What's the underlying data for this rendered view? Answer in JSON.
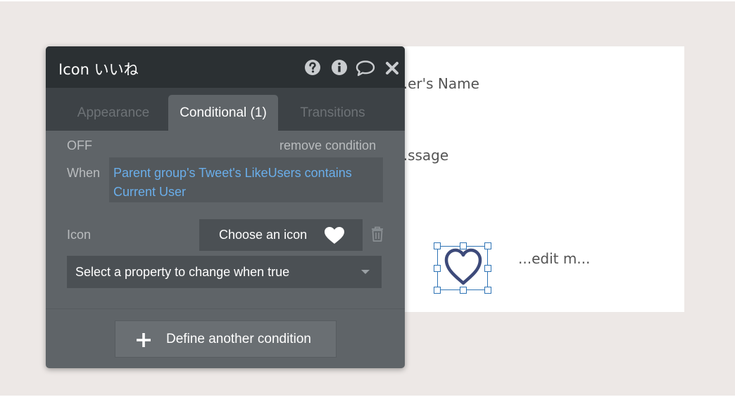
{
  "page": {
    "user_name_text": "...er's Name",
    "message_text": "...ssage",
    "edit_text": "...edit m..."
  },
  "panel": {
    "title": "Icon いいね",
    "header_icons": [
      "help-icon",
      "info-icon",
      "comment-icon",
      "close-icon"
    ],
    "tabs": [
      {
        "label": "Appearance",
        "active": false
      },
      {
        "label": "Conditional (1)",
        "active": true
      },
      {
        "label": "Transitions",
        "active": false
      }
    ],
    "condition": {
      "status": "OFF",
      "remove_label": "remove condition",
      "when_label": "When",
      "expression": "Parent group's Tweet's LikeUsers contains Current User",
      "icon_label": "Icon",
      "choose_icon_label": "Choose an icon",
      "property_select": "Select a property to change when true"
    },
    "define_label": "Define another condition"
  },
  "colors": {
    "panel_bg": "#5f6468",
    "header_bg": "#2b3033",
    "link_blue": "#6aaeea",
    "selection_blue": "#2f74b5",
    "heart_stroke": "#3d4a7a"
  }
}
